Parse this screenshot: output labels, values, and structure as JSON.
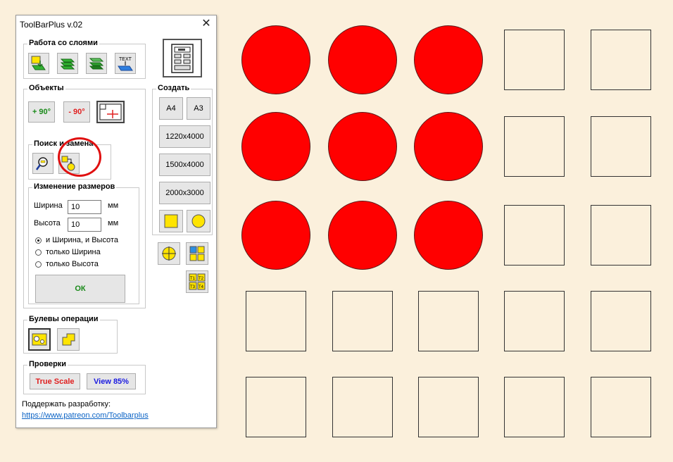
{
  "window": {
    "title": "ToolBarPlus v.02",
    "close_glyph": "✕"
  },
  "groups": {
    "layers": "Работа со слоями",
    "objects": "Объекты",
    "search": "Поиск и замена",
    "resize": "Изменение размеров",
    "boolean": "Булевы операции",
    "checks": "Проверки",
    "create": "Создать"
  },
  "objects": {
    "rotate_plus": "+ 90°",
    "rotate_minus": "- 90°"
  },
  "resize": {
    "width_label": "Ширина",
    "height_label": "Высота",
    "width_value": "10",
    "height_value": "10",
    "unit": "мм",
    "options": [
      "и Ширина, и Высота",
      "только Ширина",
      "только Высота"
    ],
    "selected_option": 0,
    "ok": "ОК"
  },
  "create": {
    "a4": "A4",
    "a3": "A3",
    "sizes": [
      "1220x4000",
      "1500x4000",
      "2000x3000"
    ]
  },
  "checks": {
    "true_scale": "True Scale",
    "view": "View 85%"
  },
  "footer": {
    "support": "Поддержать разработку:",
    "link": "https://www.patreon.com/Toolbarplus"
  },
  "icons": {
    "text_icon_label": "TEXT",
    "grid_labels": [
      "T1",
      "T2",
      "T3",
      "T4"
    ]
  },
  "colors": {
    "accent_green": "#1a8a1a",
    "accent_red": "#e02020",
    "accent_blue": "#1a1ae0",
    "shape_red": "#ff0000",
    "canvas_bg": "#fbf0dc",
    "icon_yellow": "#ffe400"
  },
  "canvas": {
    "rows": [
      [
        "circle",
        "circle",
        "circle",
        "square",
        "square"
      ],
      [
        "circle",
        "circle",
        "circle",
        "square",
        "square"
      ],
      [
        "circle",
        "circle",
        "circle",
        "square",
        "square"
      ],
      [
        "square",
        "square",
        "square",
        "square",
        "square"
      ],
      [
        "square",
        "square",
        "square",
        "square",
        "square"
      ]
    ]
  }
}
